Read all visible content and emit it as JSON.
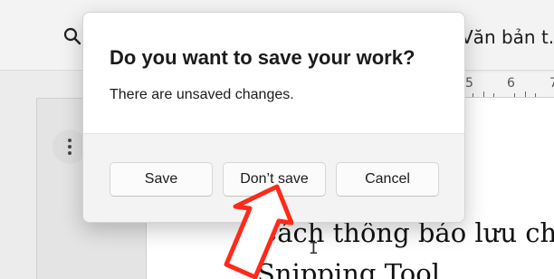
{
  "background": {
    "document_tab_label": "Văn bản t.",
    "ruler_numbers": [
      "5",
      "6",
      "7"
    ],
    "document_lines": [
      "Cách thông báo lưu ch",
      "Snipping Tool"
    ],
    "cursor_glyph": "I"
  },
  "dialog": {
    "title": "Do you want to save your work?",
    "message": "There are unsaved changes.",
    "buttons": {
      "save": "Save",
      "dont_save": "Don’t save",
      "cancel": "Cancel"
    }
  },
  "annotation": {
    "arrow_color": "#ff2a1a",
    "arrow_target": "dont-save-button"
  }
}
